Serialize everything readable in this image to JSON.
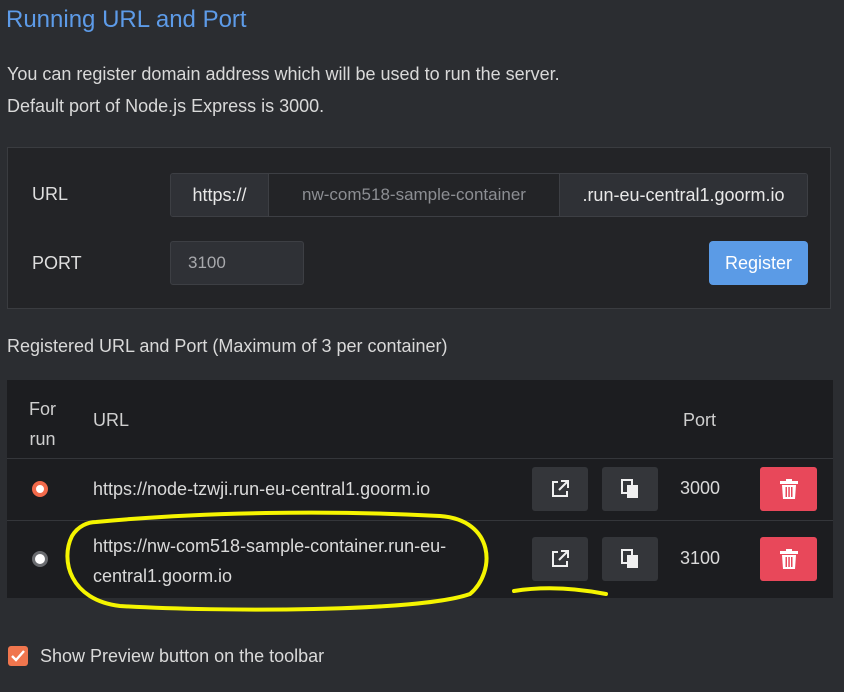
{
  "header": {
    "title": "Running URL and Port",
    "description_line1": "You can register domain address which will be used to run the server.",
    "description_line2": "Default port of Node.js Express is 3000."
  },
  "form": {
    "url_label": "URL",
    "url_prefix": "https://",
    "url_placeholder": "nw-com518-sample-container",
    "url_suffix": ".run-eu-central1.goorm.io",
    "port_label": "PORT",
    "port_value": "3100",
    "register_label": "Register"
  },
  "registered": {
    "section_label": "Registered URL and Port (Maximum of 3 per container)",
    "columns": {
      "for_run_line1": "For",
      "for_run_line2": "run",
      "url": "URL",
      "port": "Port"
    },
    "rows": [
      {
        "selected": true,
        "url_line1": "https://node-tzwji.run-eu-central1.goorm.io",
        "url_line2": "",
        "port": "3000"
      },
      {
        "selected": false,
        "url_line1": "https://nw-com518-sample-container.run-eu-",
        "url_line2": "central1.goorm.io",
        "port": "3100"
      }
    ]
  },
  "preview_option": {
    "checked": true,
    "label": "Show Preview button on the toolbar"
  },
  "colors": {
    "title": "#5d9be8",
    "register_button": "#5b9be6",
    "delete_button": "#e8485a",
    "radio_selected": "#f26a4b",
    "checkbox": "#f0764e",
    "highlight": "#f5f500"
  },
  "icons": [
    "external-link-icon",
    "copy-icon",
    "trash-icon",
    "check-icon"
  ]
}
